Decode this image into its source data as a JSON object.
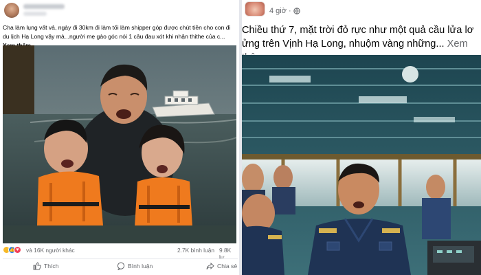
{
  "left_post": {
    "caption": "Cha làm lụng vất vả, ngày đi 30km đi làm tối làm shipper góp được chút tiền cho con đi du lịch Hạ Long vậy mà...người mẹ gào góc nói 1 câu đau xót khi nhận thithe của c...",
    "see_more": "Xem thêm",
    "image_alt": "Người cha và hai con mặc áo phao khóc giữa biển, phía sau là tàu du lịch",
    "stats": {
      "reactions": "và 16K người khác",
      "comments": "2.7K bình luận",
      "shares": "9.8K lư"
    },
    "actions": {
      "like": "Thích",
      "comment": "Bình luận",
      "share": "Chia sẻ"
    }
  },
  "right_post": {
    "time": "4 giờ",
    "caption": "Chiều thứ 7, mặt trời đỏ rực như một quả cầu lửa lơ ửng trên Vịnh Hạ Long, nhuộm vàng những...",
    "see_more": "Xem thêm",
    "image_alt": "Thuyền trưởng và thủy thủ đoàn hoảng hốt trong buồng lái tàu"
  },
  "colors": {
    "accent": "#1877f2",
    "secondary_text": "#65676b",
    "life_jacket": "#ef7a1e",
    "uniform": "#1f3354"
  },
  "icons": [
    "like-icon",
    "comment-icon",
    "share-icon",
    "globe-icon",
    "sad-reaction-icon",
    "like-reaction-icon",
    "love-reaction-icon"
  ]
}
